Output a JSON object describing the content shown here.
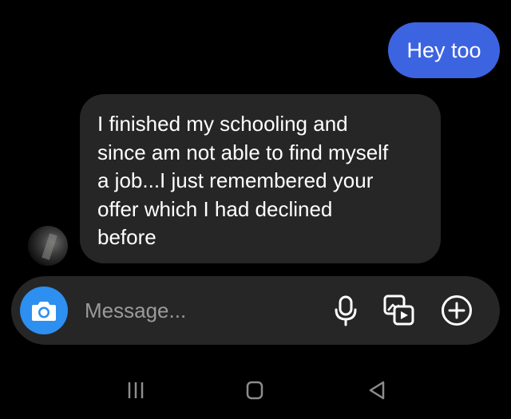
{
  "conversation": {
    "outgoing": [
      {
        "text": "Hey too"
      }
    ],
    "incoming": [
      {
        "lines": [
          "I finished my schooling and",
          "since am not able to find myself",
          "a job...I just remembered your",
          "offer which I had declined",
          "before"
        ]
      }
    ]
  },
  "composer": {
    "placeholder": "Message...",
    "icons": {
      "camera": "camera-icon",
      "mic": "microphone-icon",
      "gallery": "gallery-icon",
      "add": "plus-circle-icon"
    }
  },
  "navigation": {
    "icons": [
      "recents-icon",
      "home-icon",
      "back-icon"
    ]
  },
  "colors": {
    "background": "#000000",
    "outgoing_bubble": "#3d64e0",
    "incoming_bubble": "#262626",
    "composer": "#262626",
    "camera_button": "#2d8ff0",
    "placeholder": "#9a9a9a",
    "nav_icons": "#8c8c8c"
  }
}
